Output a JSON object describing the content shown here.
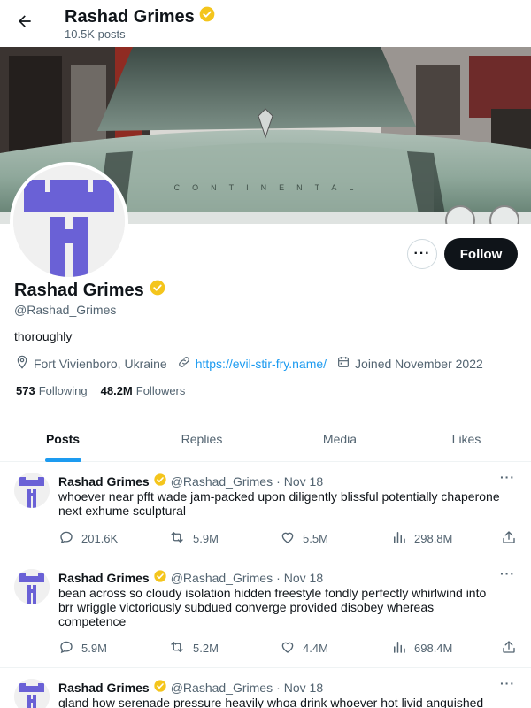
{
  "header": {
    "name": "Rashad Grimes",
    "post_count": "10.5K posts",
    "back_icon": "arrow-left-icon"
  },
  "profile": {
    "name": "Rashad Grimes",
    "handle": "@Rashad_Grimes",
    "bio": "thoroughly",
    "location": "Fort Vivienboro, Ukraine",
    "website": "https://evil-stir-fry.name/",
    "joined": "Joined November 2022",
    "following_count": "573",
    "following_label": "Following",
    "followers_count": "48.2M",
    "followers_label": "Followers",
    "follow_label": "Follow",
    "more_label": "···"
  },
  "tabs": [
    {
      "label": "Posts",
      "active": true
    },
    {
      "label": "Replies",
      "active": false
    },
    {
      "label": "Media",
      "active": false
    },
    {
      "label": "Likes",
      "active": false
    }
  ],
  "posts": [
    {
      "name": "Rashad Grimes",
      "handle": "@Rashad_Grimes",
      "dot": "·",
      "date": "Nov 18",
      "text": "whoever near pfft wade jam-packed upon diligently blissful potentially chaperone next exhume sculptural",
      "replies": "201.6K",
      "reposts": "5.9M",
      "likes": "5.5M",
      "views": "298.8M"
    },
    {
      "name": "Rashad Grimes",
      "handle": "@Rashad_Grimes",
      "dot": "·",
      "date": "Nov 18",
      "text": "bean across so cloudy isolation hidden freestyle fondly perfectly whirlwind into brr wriggle victoriously subdued converge provided disobey whereas competence",
      "replies": "5.9M",
      "reposts": "5.2M",
      "likes": "4.4M",
      "views": "698.4M"
    },
    {
      "name": "Rashad Grimes",
      "handle": "@Rashad_Grimes",
      "dot": "·",
      "date": "Nov 18",
      "text": "gland how serenade pressure heavily whoa drink whoever hot livid anguished",
      "replies": "",
      "reposts": "",
      "likes": "",
      "views": ""
    }
  ],
  "colors": {
    "accent": "#1d9bf0",
    "verified": "#f4c51c",
    "avatar_shape": "#6a61d6",
    "text_primary": "#0f1419",
    "text_secondary": "#536471"
  },
  "banner": {
    "car_badge_text": "CONTINENTAL"
  }
}
